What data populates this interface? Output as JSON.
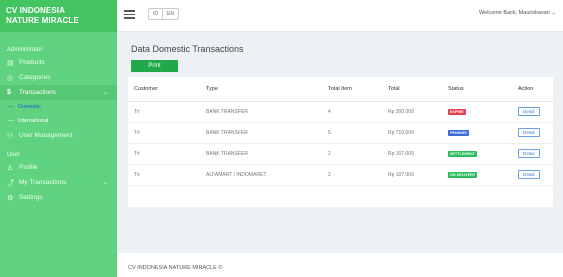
{
  "brand": {
    "line1": "CV INDONESIA",
    "line2": "NATURE MIRACLE"
  },
  "sidebar": {
    "section_admin": "Administrator",
    "items": [
      {
        "label": "Products",
        "icon": "box-icon"
      },
      {
        "label": "Categories",
        "icon": "grid-icon"
      },
      {
        "label": "Transactions",
        "icon": "dollar-icon"
      }
    ],
    "sub_items": [
      {
        "label": "Domestic"
      },
      {
        "label": "International"
      }
    ],
    "user_mgmt": {
      "label": "User Management"
    },
    "section_user": "User",
    "user_items": [
      {
        "label": "Profile"
      },
      {
        "label": "My Transactions"
      },
      {
        "label": "Settings"
      }
    ]
  },
  "topbar": {
    "lang": [
      "ID",
      "EN"
    ],
    "welcome": "Welcome Back, Mauriskavan"
  },
  "main": {
    "title": "Data Domestic Transactions",
    "print_label": "Print",
    "columns": [
      "Customer",
      "Type",
      "Total Item",
      "Total",
      "Status",
      "Action"
    ],
    "rows": [
      {
        "customer": "Tri",
        "type": "BANK TRANSFER",
        "items": "4",
        "total": "Rp 300.000",
        "status": "EXPIRE",
        "status_color": "#e0434f",
        "action": "Detail"
      },
      {
        "customer": "Tri",
        "type": "BANK TRANSFER",
        "items": "5",
        "total": "Rp 710.000",
        "status": "PENDING",
        "status_color": "#3a6ad6",
        "action": "Detail"
      },
      {
        "customer": "Tri",
        "type": "BANK TRANSFER",
        "items": "2",
        "total": "Rp 107.000",
        "status": "SETTLEMENT",
        "status_color": "#2bbd5a",
        "action": "Detail"
      },
      {
        "customer": "Tri",
        "type": "ALFAMART / INDOMARET",
        "items": "2",
        "total": "Rp 107.000",
        "status": "ON DELIVERY",
        "status_color": "#2bbd5a",
        "action": "Detail"
      }
    ]
  },
  "footer": {
    "text": "CV INDONESIA NATURE MIRACLE ©"
  }
}
